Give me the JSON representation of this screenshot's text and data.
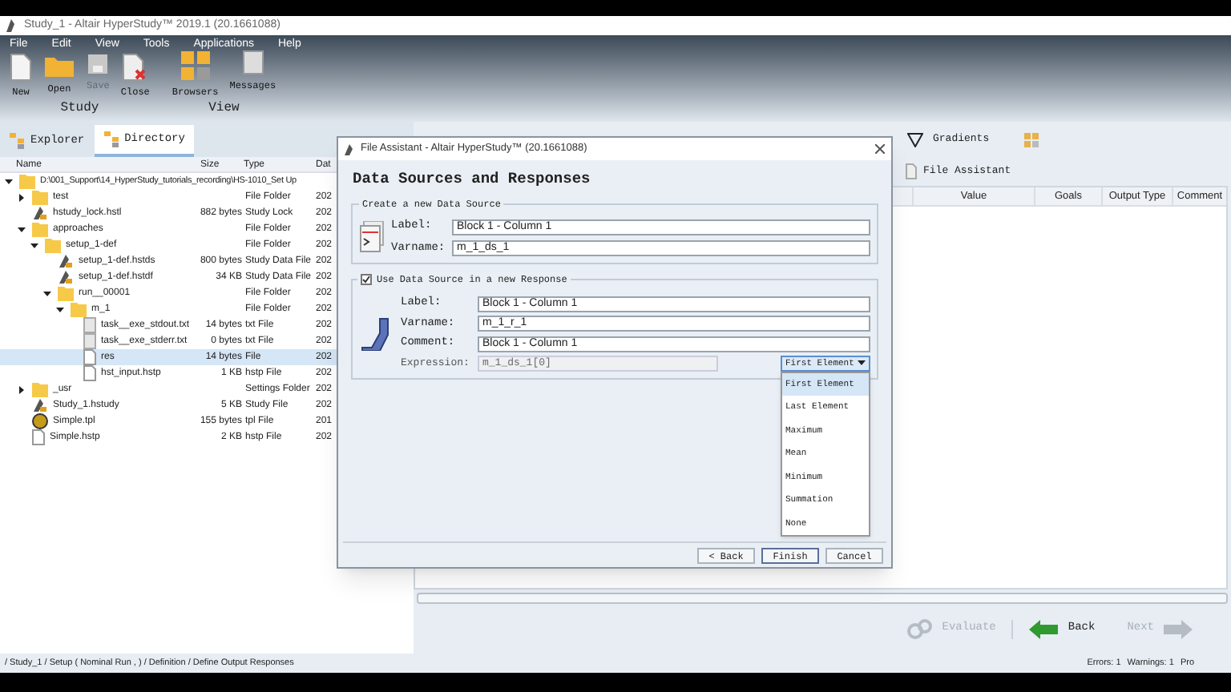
{
  "window": {
    "title": "Study_1 - Altair HyperStudy™ 2019.1 (20.1661088)"
  },
  "menu": [
    "File",
    "Edit",
    "View",
    "Tools",
    "Applications",
    "Help"
  ],
  "ribbon": [
    {
      "group": "Study",
      "tools": [
        {
          "label": "New",
          "kind": "page",
          "disabled": false
        },
        {
          "label": "Open",
          "kind": "folder",
          "disabled": false
        },
        {
          "label": "Save",
          "kind": "disk",
          "disabled": true
        },
        {
          "label": "Close",
          "kind": "close",
          "disabled": false
        }
      ]
    },
    {
      "group": "View",
      "tools": [
        {
          "label": "Browsers",
          "kind": "browsers",
          "disabled": false
        },
        {
          "label": "Messages",
          "kind": "messages",
          "disabled": false
        }
      ]
    }
  ],
  "panel_tabs": [
    {
      "label": "Explorer",
      "selected": false
    },
    {
      "label": "Directory",
      "selected": true
    }
  ],
  "tree": {
    "columns": [
      "Name",
      "Size",
      "Type",
      "Dat"
    ],
    "rows": [
      {
        "name": "D:\\001_Support\\14_HyperStudy_tutorials_recording\\HS-1010_Set Up",
        "kind": "folder",
        "expanded": true,
        "selected": false,
        "children": [
          {
            "name": "test",
            "type": "File Folder",
            "date": "202",
            "kind": "folder",
            "expanded": false,
            "selected": false
          },
          {
            "name": "hstudy_lock.hstl",
            "size": "882 bytes",
            "type": "Study Lock",
            "date": "202",
            "kind": "study",
            "selected": false
          },
          {
            "name": "approaches",
            "type": "File Folder",
            "date": "202",
            "kind": "folder",
            "expanded": true,
            "selected": false,
            "children": [
              {
                "name": "setup_1-def",
                "type": "File Folder",
                "date": "202",
                "kind": "folder",
                "expanded": true,
                "selected": false,
                "children": [
                  {
                    "name": "setup_1-def.hstds",
                    "size": "800 bytes",
                    "type": "Study Data File",
                    "date": "202",
                    "kind": "study",
                    "selected": false
                  },
                  {
                    "name": "setup_1-def.hstdf",
                    "size": "34 KB",
                    "type": "Study Data File",
                    "date": "202",
                    "kind": "study",
                    "selected": false
                  },
                  {
                    "name": "run__00001",
                    "type": "File Folder",
                    "date": "202",
                    "kind": "folder",
                    "expanded": true,
                    "selected": false,
                    "children": [
                      {
                        "name": "m_1",
                        "type": "File Folder",
                        "date": "202",
                        "kind": "folder",
                        "expanded": true,
                        "selected": false,
                        "children": [
                          {
                            "name": "task__exe_stdout.txt",
                            "size": "14 bytes",
                            "type": "txt File",
                            "date": "202",
                            "kind": "text",
                            "selected": false
                          },
                          {
                            "name": "task__exe_stderr.txt",
                            "size": "0 bytes",
                            "type": "txt File",
                            "date": "202",
                            "kind": "text",
                            "selected": false
                          },
                          {
                            "name": "res",
                            "size": "14 bytes",
                            "type": "File",
                            "date": "202",
                            "kind": "file",
                            "selected": true
                          },
                          {
                            "name": "hst_input.hstp",
                            "size": "1 KB",
                            "type": "hstp File",
                            "date": "202",
                            "kind": "file",
                            "selected": false
                          }
                        ]
                      }
                    ]
                  }
                ]
              }
            ]
          },
          {
            "name": "_usr",
            "type": "Settings Folder",
            "date": "202",
            "kind": "folder",
            "expanded": false,
            "selected": false
          },
          {
            "name": "Study_1.hstudy",
            "size": "5 KB",
            "type": "Study File",
            "date": "202",
            "kind": "study",
            "selected": false
          },
          {
            "name": "Simple.tpl",
            "size": "155 bytes",
            "type": "tpl File",
            "date": "201",
            "kind": "tpl",
            "selected": false
          },
          {
            "name": "Simple.hstp",
            "size": "2 KB",
            "type": "hstp File",
            "date": "202",
            "kind": "file",
            "selected": false
          }
        ]
      }
    ]
  },
  "toolbar": {
    "gradients": "Gradients",
    "file_assistant": "File Assistant"
  },
  "responses_table": {
    "columns": [
      "Value",
      "Goals",
      "Output Type",
      "Comment"
    ]
  },
  "footer_buttons": [
    {
      "label": "Evaluate",
      "kind": "evaluate",
      "disabled": true
    },
    {
      "label": "Back",
      "kind": "back",
      "disabled": false
    },
    {
      "label": "Next",
      "kind": "next",
      "disabled": true
    }
  ],
  "status_bar": {
    "path": "/ Study_1 / Setup ( Nominal Run , ) / Definition / Define Output Responses",
    "errors": "Errors: 1",
    "warnings": "Warnings: 1",
    "extra": "Pro"
  },
  "dialog": {
    "title": "File Assistant - Altair HyperStudy™ (20.1661088)",
    "heading": "Data Sources and Responses",
    "source_group": {
      "title": "Create a new Data Source",
      "fields": [
        {
          "label": "Label:",
          "value": "Block 1 - Column 1"
        },
        {
          "label": "Varname:",
          "value": "m_1_ds_1"
        }
      ]
    },
    "response_group": {
      "title": "Use Data Source in a new Response",
      "checked": true,
      "fields": [
        {
          "label": "Label:",
          "value": "Block 1 - Column 1"
        },
        {
          "label": "Varname:",
          "value": "m_1_r_1"
        },
        {
          "label": "Comment:",
          "value": "Block 1 - Column 1"
        }
      ],
      "expression": {
        "label": "Expression:",
        "value": "m_1_ds_1[0]",
        "disabled": true
      },
      "dropdown": {
        "value": "First Element",
        "open": true,
        "options": [
          {
            "label": "First Element",
            "selected": true
          },
          {
            "label": "Last Element",
            "selected": false
          },
          {
            "label": "Maximum",
            "selected": false
          },
          {
            "label": "Mean",
            "selected": false
          },
          {
            "label": "Minimum",
            "selected": false
          },
          {
            "label": "Summation",
            "selected": false
          },
          {
            "label": "None",
            "selected": false
          }
        ]
      }
    },
    "buttons": [
      "< Back",
      "Finish",
      "Cancel"
    ]
  }
}
